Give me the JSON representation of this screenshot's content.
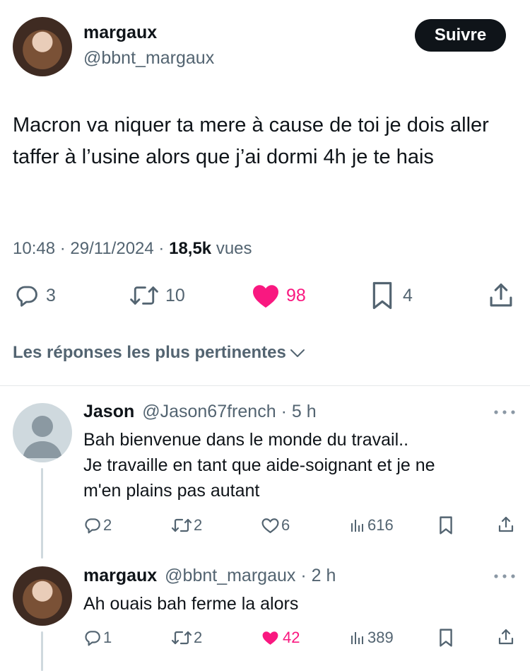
{
  "tweet": {
    "author_name": "margaux",
    "author_handle": "@bbnt_margaux",
    "follow_label": "Suivre",
    "text": "Macron va niquer ta mere à cause de toi je dois aller taffer à l’usine alors que j’ai dormi 4h je te hais",
    "time": "10:48",
    "date": "29/11/2024",
    "views_count": "18,5k",
    "views_label": "vues",
    "replies": "3",
    "retweets": "10",
    "likes": "98",
    "bookmarks": "4"
  },
  "sort": {
    "label": "Les réponses les plus pertinentes"
  },
  "replies": [
    {
      "name": "Jason",
      "handle": "@Jason67french",
      "age": "5 h",
      "line1": "Bah bienvenue dans le monde du travail..",
      "line2": "Je travaille en tant que aide-soignant et je ne",
      "line3": "m'en plains pas autant",
      "replies": "2",
      "retweets": "2",
      "likes": "6",
      "views": "616"
    },
    {
      "name": "margaux",
      "handle": "@bbnt_margaux",
      "age": "2 h",
      "line1": "Ah ouais bah ferme la alors",
      "replies": "1",
      "retweets": "2",
      "likes": "42",
      "views": "389"
    }
  ],
  "colors": {
    "text": "#0f1419",
    "muted": "#536471",
    "like_active": "#f91880",
    "follow_bg": "#0f1419",
    "divider": "#eff3f4"
  },
  "icons": [
    "reply-icon",
    "retweet-icon",
    "heart-icon",
    "bookmark-icon",
    "share-icon",
    "views-icon",
    "more-icon",
    "chevron-down-icon"
  ]
}
